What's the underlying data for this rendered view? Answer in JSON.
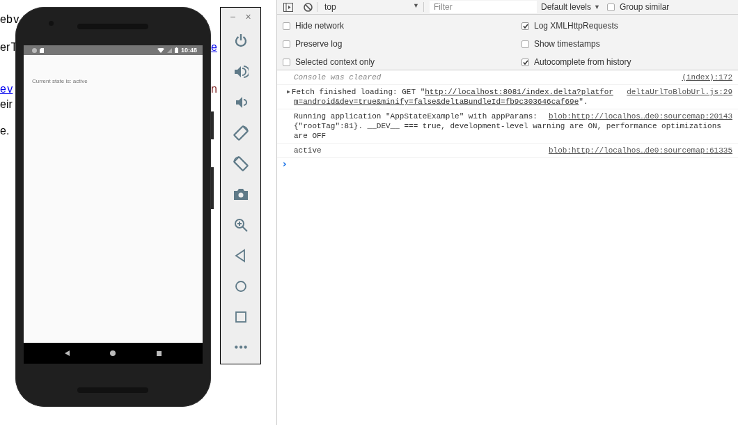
{
  "background_page": {
    "lines": [
      {
        "left": {
          "kind": "text",
          "text": "eb v"
        }
      },
      {
        "left": {
          "kind": "text",
          "text": "er T"
        },
        "right": {
          "kind": "link",
          "text": "e"
        }
      },
      {
        "left": {
          "kind": "link",
          "text": "e v"
        },
        "right": {
          "kind": "text",
          "text": "n"
        }
      },
      {
        "left": {
          "kind": "text",
          "text": "eir"
        }
      },
      {
        "left": {
          "kind": "text",
          "text": "e."
        }
      }
    ]
  },
  "phone": {
    "status_time": "10:48",
    "content_text": "Current state is: active"
  },
  "emulator_toolbar": {
    "minimize": "−",
    "close": "×",
    "more": "•••"
  },
  "devtools": {
    "toolbar": {
      "context": "top",
      "filter_placeholder": "Filter",
      "levels": "Default levels",
      "levels_caret": "▼",
      "context_caret": "▼",
      "group_similar": {
        "label": "Group similar",
        "checked": false
      }
    },
    "settings": [
      {
        "label": "Hide network",
        "checked": false
      },
      {
        "label": "Log XMLHttpRequests",
        "checked": true
      },
      {
        "label": "Preserve log",
        "checked": false
      },
      {
        "label": "Show timestamps",
        "checked": false
      },
      {
        "label": "Selected context only",
        "checked": false
      },
      {
        "label": "Autocomplete from history",
        "checked": true
      }
    ],
    "messages": [
      {
        "kind": "info",
        "text": "Console was cleared",
        "source": "(index):172"
      },
      {
        "kind": "fetch",
        "toggle": "▶",
        "before": "Fetch finished loading: GET \"",
        "link_lines": [
          "http://localhost:8081/index.delta?platfor",
          "m=android&dev=true&minify=false&deltaBundleId=fb9c303646caf69e"
        ],
        "after": "\".",
        "source": "deltaUrlToBlobUrl.js:29"
      },
      {
        "kind": "log",
        "lines": [
          "Running application \"AppStateExample\" with appParams:",
          "{\"rootTag\":81}. __DEV__ === true, development-level warning are ON, performance optimizations",
          "are OFF"
        ],
        "source": "blob:http://localhos…de0:sourcemap:20143"
      },
      {
        "kind": "log",
        "lines": [
          "active"
        ],
        "source": "blob:http://localhos…de0:sourcemap:61335"
      }
    ],
    "prompt": "›"
  }
}
